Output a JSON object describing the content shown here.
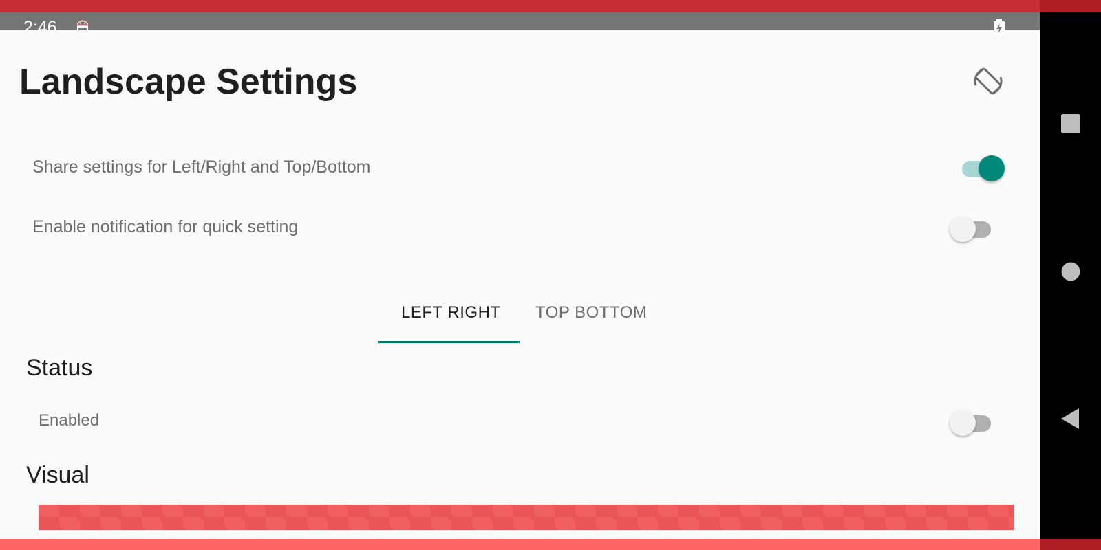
{
  "status_bar": {
    "time": "2:46",
    "app_icon": "android-debug-icon",
    "battery_icon": "battery-charging-icon"
  },
  "nav_bar": {
    "recent_icon": "square-recent-apps-icon",
    "home_icon": "circle-home-icon",
    "back_icon": "triangle-back-icon"
  },
  "header": {
    "title": "Landscape Settings",
    "action_icon": "screen-rotation-icon"
  },
  "settings": {
    "share": {
      "label": "Share settings for Left/Right and Top/Bottom",
      "checked": true
    },
    "notification": {
      "label": "Enable notification for quick setting",
      "checked": false
    }
  },
  "tabs": [
    {
      "label": "LEFT RIGHT",
      "selected": true
    },
    {
      "label": "TOP BOTTOM",
      "selected": false
    }
  ],
  "sections": {
    "status": {
      "title": "Status",
      "enabled": {
        "label": "Enabled",
        "checked": false
      }
    },
    "visual": {
      "title": "Visual"
    }
  },
  "colors": {
    "accent": "#00897b",
    "accent_track": "#a8d7d3",
    "status_bar": "#757575",
    "top_edge": "#c62f35",
    "bottom_edge": "#ff6464",
    "visual_bar": "#f06060"
  }
}
